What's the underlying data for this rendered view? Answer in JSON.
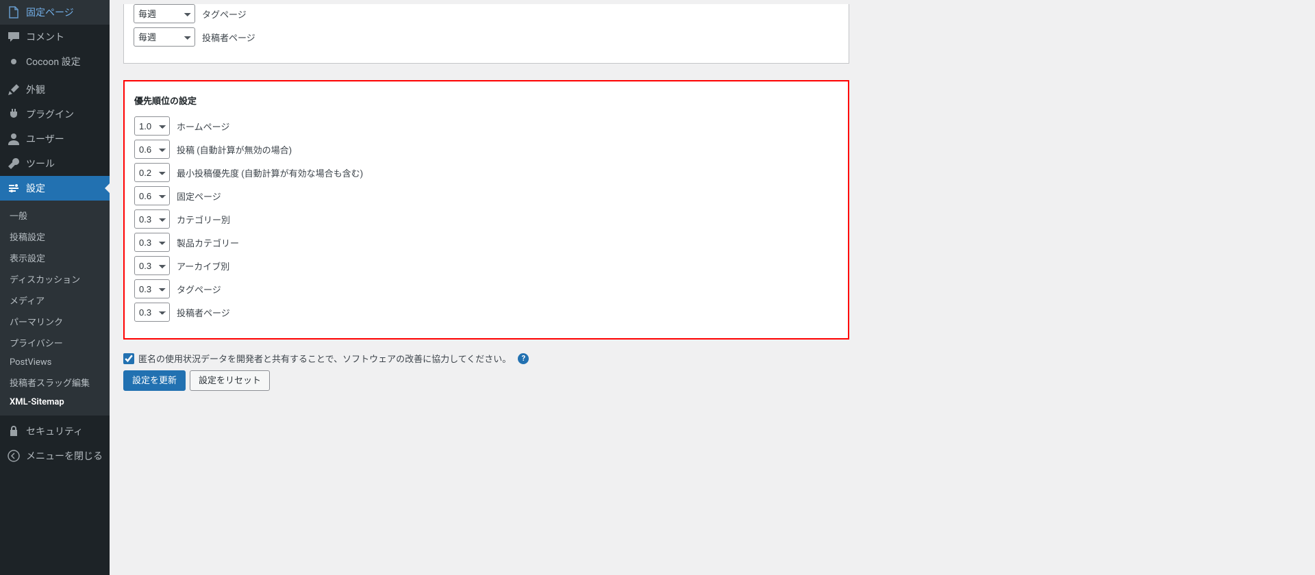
{
  "sidebar": {
    "top_items": [
      {
        "name": "pages",
        "label": "固定ページ",
        "icon": "page"
      },
      {
        "name": "comments",
        "label": "コメント",
        "icon": "comment"
      },
      {
        "name": "cocoon",
        "label": "Cocoon 設定",
        "icon": "dot"
      }
    ],
    "mid_items": [
      {
        "name": "appearance",
        "label": "外観",
        "icon": "brush"
      },
      {
        "name": "plugins",
        "label": "プラグイン",
        "icon": "plug"
      },
      {
        "name": "users",
        "label": "ユーザー",
        "icon": "user"
      },
      {
        "name": "tools",
        "label": "ツール",
        "icon": "wrench"
      }
    ],
    "settings": {
      "label": "設定",
      "icon": "sliders",
      "children": [
        {
          "name": "general",
          "label": "一般"
        },
        {
          "name": "writing",
          "label": "投稿設定"
        },
        {
          "name": "reading",
          "label": "表示設定"
        },
        {
          "name": "discussion",
          "label": "ディスカッション"
        },
        {
          "name": "media",
          "label": "メディア"
        },
        {
          "name": "permalink",
          "label": "パーマリンク"
        },
        {
          "name": "privacy",
          "label": "プライバシー"
        },
        {
          "name": "postviews",
          "label": "PostViews"
        },
        {
          "name": "author-slug",
          "label": "投稿者スラッグ編集"
        },
        {
          "name": "xml-sitemap",
          "label": "XML-Sitemap",
          "current": true
        }
      ]
    },
    "security": {
      "label": "セキュリティ",
      "icon": "lock"
    },
    "collapse": {
      "label": "メニューを閉じる",
      "icon": "collapse"
    }
  },
  "freq_box": {
    "rows": [
      {
        "name": "tag",
        "value": "毎週",
        "label": "タグページ"
      },
      {
        "name": "author",
        "value": "毎週",
        "label": "投稿者ページ"
      }
    ]
  },
  "priority_box": {
    "title": "優先順位の設定",
    "rows": [
      {
        "name": "home",
        "value": "1.0",
        "label": "ホームページ"
      },
      {
        "name": "posts",
        "value": "0.6",
        "label": "投稿 (自動計算が無効の場合)"
      },
      {
        "name": "min-post",
        "value": "0.2",
        "label": "最小投稿優先度 (自動計算が有効な場合も含む)"
      },
      {
        "name": "pages",
        "value": "0.6",
        "label": "固定ページ"
      },
      {
        "name": "categories",
        "value": "0.3",
        "label": "カテゴリー別"
      },
      {
        "name": "prod-cat",
        "value": "0.3",
        "label": "製品カテゴリー"
      },
      {
        "name": "archives",
        "value": "0.3",
        "label": "アーカイブ別"
      },
      {
        "name": "tags",
        "value": "0.3",
        "label": "タグページ"
      },
      {
        "name": "authors",
        "value": "0.3",
        "label": "投稿者ページ"
      }
    ]
  },
  "share": {
    "checked": true,
    "label": "匿名の使用状況データを開発者と共有することで、ソフトウェアの改善に協力してください。"
  },
  "buttons": {
    "save": "設定を更新",
    "reset": "設定をリセット"
  }
}
